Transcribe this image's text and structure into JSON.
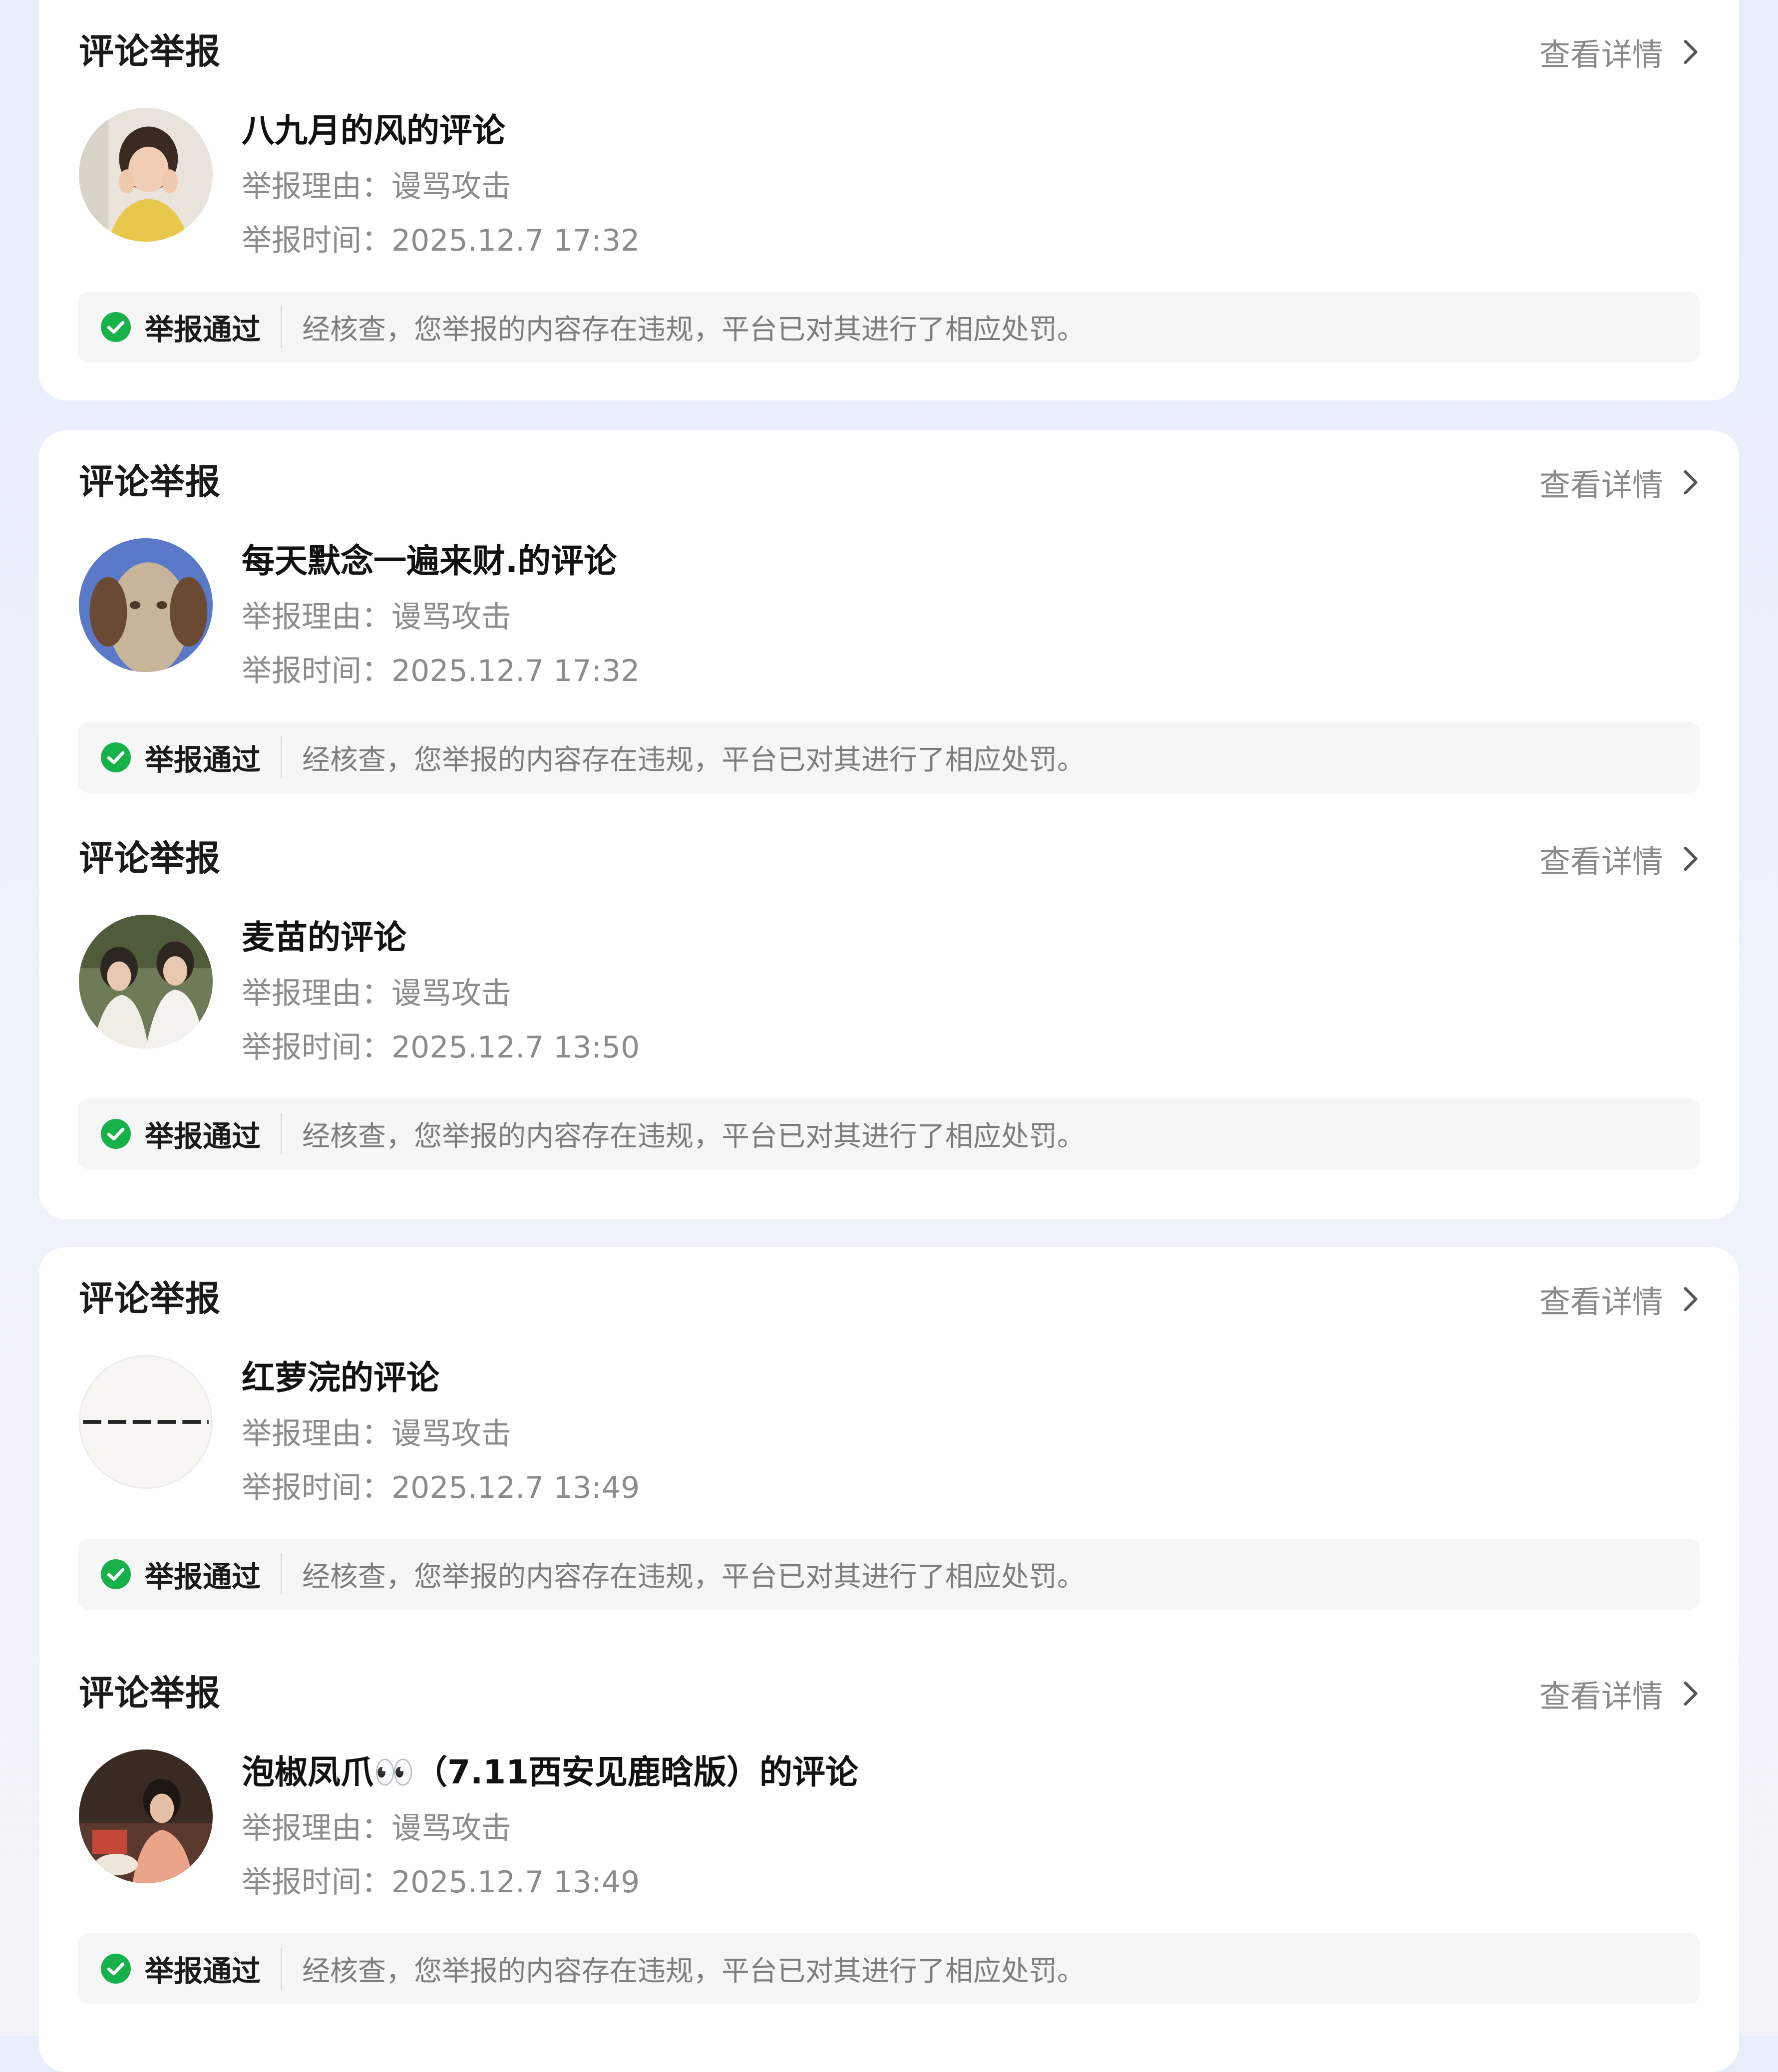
{
  "cards": [
    {
      "title": "评论举报",
      "detail_label": "查看详情",
      "name": "八九月的风的评论",
      "reason_label": "举报理由：",
      "reason": "谩骂攻击",
      "time_label": "举报时间：",
      "time": "2025.12.7 17:32",
      "status": "举报通过",
      "result_text": "经核查，您举报的内容存在违规，平台已对其进行了相应处罚。"
    },
    {
      "title": "评论举报",
      "detail_label": "查看详情",
      "name": "每天默念一遍来财.的评论",
      "reason_label": "举报理由：",
      "reason": "谩骂攻击",
      "time_label": "举报时间：",
      "time": "2025.12.7 17:32",
      "status": "举报通过",
      "result_text": "经核查，您举报的内容存在违规，平台已对其进行了相应处罚。"
    },
    {
      "title": "评论举报",
      "detail_label": "查看详情",
      "name": "麦苗的评论",
      "reason_label": "举报理由：",
      "reason": "谩骂攻击",
      "time_label": "举报时间：",
      "time": "2025.12.7 13:50",
      "status": "举报通过",
      "result_text": "经核查，您举报的内容存在违规，平台已对其进行了相应处罚。"
    },
    {
      "title": "评论举报",
      "detail_label": "查看详情",
      "name": "红萝浣的评论",
      "reason_label": "举报理由：",
      "reason": "谩骂攻击",
      "time_label": "举报时间：",
      "time": "2025.12.7 13:49",
      "status": "举报通过",
      "result_text": "经核查，您举报的内容存在违规，平台已对其进行了相应处罚。"
    },
    {
      "title": "评论举报",
      "detail_label": "查看详情",
      "name": "泡椒凤爪👀（7.11西安见鹿晗版）的评论",
      "reason_label": "举报理由：",
      "reason": "谩骂攻击",
      "time_label": "举报时间：",
      "time": "2025.12.7 13:49",
      "status": "举报通过",
      "result_text": "经核查，您举报的内容存在违规，平台已对其进行了相应处罚。"
    }
  ],
  "colors": {
    "success_green": "#17b14a",
    "card_bg": "#ffffff",
    "bar_bg": "#f6f6f7"
  },
  "icons": {
    "detail": "chevron-right-icon",
    "status": "check-circle-icon"
  }
}
